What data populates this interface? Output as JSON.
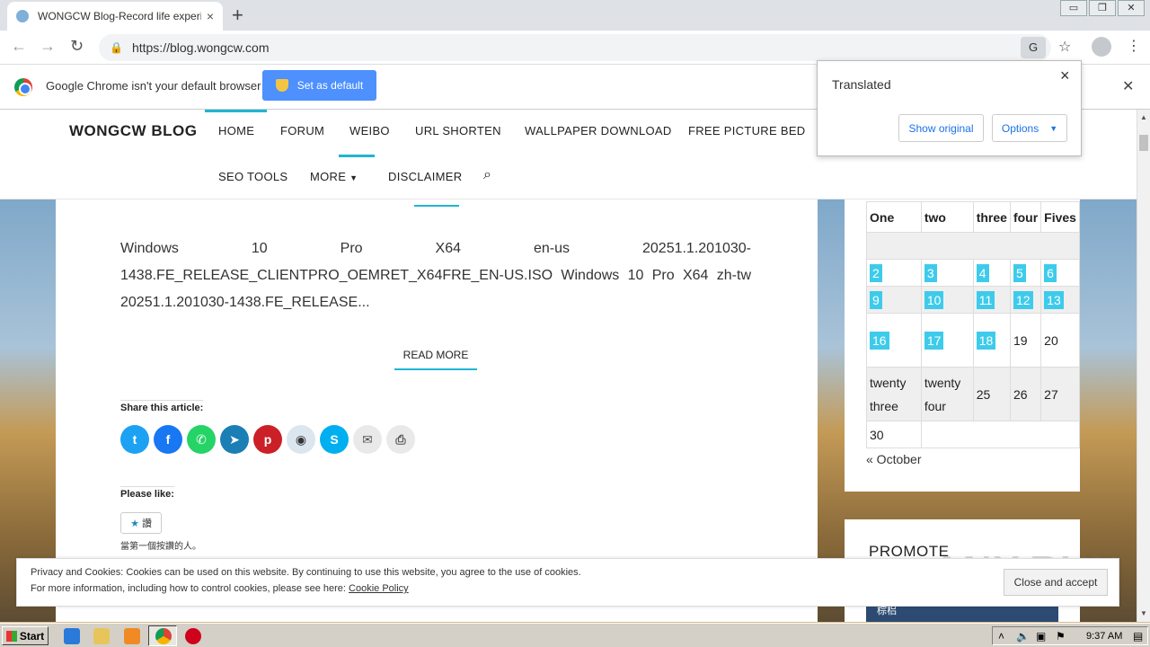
{
  "browser": {
    "tab_title": "WONGCW Blog-Record life experience",
    "tab_close": "×",
    "new_tab": "+",
    "url": "https://blog.wongcw.com",
    "nav_back": "←",
    "nav_forward": "→",
    "nav_reload": "↻",
    "window_min": "▭",
    "window_restore": "❐",
    "window_close": "✕",
    "star": "☆",
    "menu": "⋮",
    "translate_glyph": "G"
  },
  "infobar": {
    "message": "Google Chrome isn't your default browser",
    "set_default_label": "Set as default",
    "close": "✕"
  },
  "translate_popup": {
    "title": "Translated",
    "close": "×",
    "show_original_label": "Show original",
    "options_label": "Options"
  },
  "site": {
    "brand": "WONGCW BLOG",
    "nav": {
      "home": "HOME",
      "forum": "FORUM",
      "weibo": "WEIBO",
      "url_shorten": "URL SHORTEN",
      "wallpaper": "WALLPAPER DOWNLOAD",
      "picture_bed": "FREE PICTURE BED",
      "seo": "SEO TOOLS",
      "more": "MORE",
      "disclaimer": "DISCLAIMER"
    },
    "excerpt": "Windows 10 Pro X64 en-us 20251.1.201030-1438.FE_RELEASE_CLIENTPRO_OEMRET_X64FRE_EN-US.ISO Windows 10 Pro X64 zh-tw 20251.1.201030-1438.FE_RELEASE...",
    "read_more": "READ MORE",
    "share_heading": "Share this article:",
    "share_buttons": [
      "twitter",
      "facebook",
      "whatsapp",
      "telegram",
      "pinterest",
      "reddit",
      "skype",
      "email",
      "print"
    ],
    "like_heading": "Please like:",
    "like_button": "讚",
    "like_text": "當第一個按讚的人。"
  },
  "calendar": {
    "headers": [
      "One",
      "two",
      "three",
      "four",
      "Fives"
    ],
    "row1": [
      "2",
      "3",
      "4",
      "5",
      "6"
    ],
    "row2": [
      "9",
      "10",
      "11",
      "12",
      "13"
    ],
    "row3": [
      "16",
      "17",
      "18",
      "19",
      "20"
    ],
    "row4": [
      "twenty three",
      "twenty four",
      "25",
      "26",
      "27"
    ],
    "row5": [
      "30"
    ],
    "prev_link": "« October"
  },
  "promote": {
    "title": "PROMOTE",
    "banner_text": "棕梠"
  },
  "cookie": {
    "line1": "Privacy and Cookies: Cookies can be used on this website. By continuing to use this website, you agree to the use of cookies.",
    "line2_prefix": "For more information, including how to control cookies, please see here: ",
    "policy_link": "Cookie Policy",
    "accept_label": "Close and accept"
  },
  "watermark": "ANY.RUN",
  "taskbar": {
    "start": "Start",
    "time": "9:37 AM"
  },
  "colors": {
    "accent": "#1eb5d3",
    "calendar_highlight": "#3ecbeb",
    "set_default_blue": "#4d90fe"
  }
}
